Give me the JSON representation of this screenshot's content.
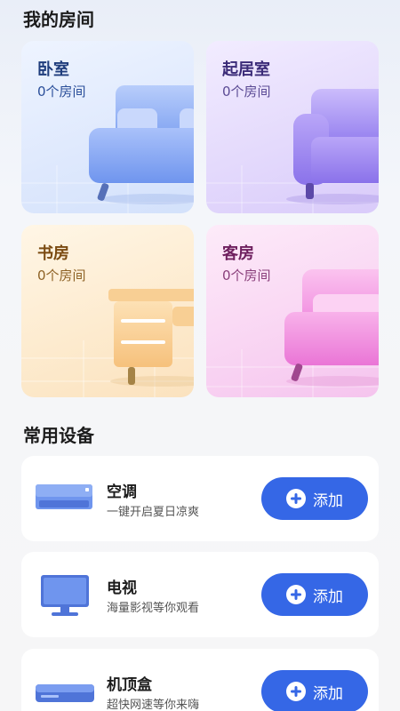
{
  "rooms_section": {
    "title": "我的房间",
    "rooms": [
      {
        "name": "卧室",
        "count": "0个房间",
        "icon": "sofa-blue-icon"
      },
      {
        "name": "起居室",
        "count": "0个房间",
        "icon": "sofa-purple-icon"
      },
      {
        "name": "书房",
        "count": "0个房间",
        "icon": "desk-orange-icon"
      },
      {
        "name": "客房",
        "count": "0个房间",
        "icon": "sofa-pink-icon"
      }
    ]
  },
  "devices_section": {
    "title": "常用设备",
    "devices": [
      {
        "name": "空调",
        "desc": "一键开启夏日凉爽",
        "button": "添加",
        "icon": "air-conditioner-icon"
      },
      {
        "name": "电视",
        "desc": "海量影视等你观看",
        "button": "添加",
        "icon": "tv-icon"
      },
      {
        "name": "机顶盒",
        "desc": "超快网速等你来嗨",
        "button": "添加",
        "icon": "set-top-box-icon"
      }
    ]
  },
  "colors": {
    "accent": "#3567e6",
    "bedroom": "#8fb0f5",
    "living": "#a38cf2",
    "study": "#f7c88a",
    "guest": "#f08ee0"
  }
}
